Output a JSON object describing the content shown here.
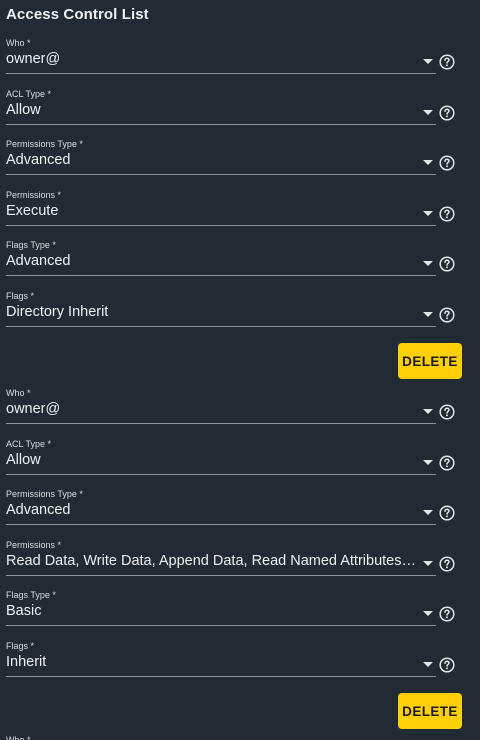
{
  "acl": {
    "title": "Access Control List",
    "delete_label": "DELETE",
    "entries": [
      {
        "fields": [
          {
            "label": "Who *",
            "value": "owner@"
          },
          {
            "label": "ACL Type *",
            "value": "Allow"
          },
          {
            "label": "Permissions Type *",
            "value": "Advanced"
          },
          {
            "label": "Permissions *",
            "value": "Execute"
          },
          {
            "label": "Flags Type *",
            "value": "Advanced"
          },
          {
            "label": "Flags *",
            "value": "Directory Inherit"
          }
        ]
      },
      {
        "fields": [
          {
            "label": "Who *",
            "value": "owner@"
          },
          {
            "label": "ACL Type *",
            "value": "Allow"
          },
          {
            "label": "Permissions Type *",
            "value": "Advanced"
          },
          {
            "label": "Permissions *",
            "value": "Read Data, Write Data, Append Data, Read Named Attributes, Wri…"
          },
          {
            "label": "Flags Type *",
            "value": "Basic"
          },
          {
            "label": "Flags *",
            "value": "Inherit"
          }
        ]
      }
    ],
    "next_entry_label": "Who *"
  },
  "colors": {
    "background": "#222b33",
    "accent": "#fdd00a"
  }
}
